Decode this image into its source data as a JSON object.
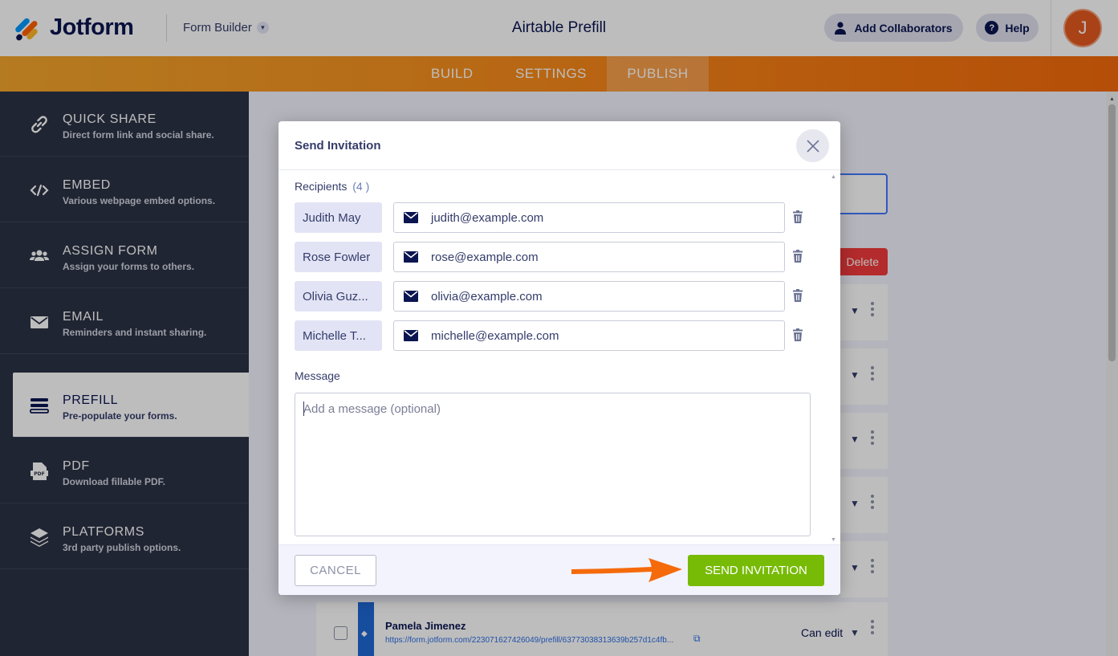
{
  "app": {
    "logo_text": "Jotform",
    "builder_menu": "Form Builder",
    "form_title": "Airtable Prefill",
    "add_collaborators": "Add Collaborators",
    "help": "Help",
    "avatar_initial": "J",
    "accent_color": "#f88a1a"
  },
  "nav": {
    "tabs": [
      {
        "label": "BUILD"
      },
      {
        "label": "SETTINGS"
      },
      {
        "label": "PUBLISH"
      }
    ],
    "active": "PUBLISH"
  },
  "sidebar": {
    "items": [
      {
        "title": "QUICK SHARE",
        "desc": "Direct form link and social share.",
        "icon": "link-icon"
      },
      {
        "title": "EMBED",
        "desc": "Various webpage embed options.",
        "icon": "code-icon"
      },
      {
        "title": "ASSIGN FORM",
        "desc": "Assign your forms to others.",
        "icon": "users-icon"
      },
      {
        "title": "EMAIL",
        "desc": "Reminders and instant sharing.",
        "icon": "envelope-icon"
      },
      {
        "title": "PREFILL",
        "desc": "Pre-populate your forms.",
        "icon": "prefill-icon"
      },
      {
        "title": "PDF",
        "desc": "Download fillable PDF.",
        "icon": "pdf-icon"
      },
      {
        "title": "PLATFORMS",
        "desc": "3rd party publish options.",
        "icon": "layers-icon"
      }
    ],
    "active": "PREFILL"
  },
  "background": {
    "delete_label": "Delete",
    "last_row": {
      "name": "Pamela Jimenez",
      "link": "https://form.jotform.com/223071627426049/prefill/63773038313639b257d1c4fb...",
      "permission": "Can edit"
    }
  },
  "modal": {
    "title": "Send Invitation",
    "recipients_label": "Recipients",
    "recipients_count": "(4 )",
    "recipients": [
      {
        "name": "Judith May",
        "email": "judith@example.com"
      },
      {
        "name": "Rose Fowler",
        "email": "rose@example.com"
      },
      {
        "name": "Olivia Guz...",
        "email": "olivia@example.com"
      },
      {
        "name": "Michelle T...",
        "email": "michelle@example.com"
      }
    ],
    "message_label": "Message",
    "message_placeholder": "Add a message (optional)",
    "message_value": "",
    "cancel_label": "CANCEL",
    "send_label": "SEND INVITATION",
    "send_color": "#78bb07",
    "arrow_color": "#f56a0b"
  }
}
